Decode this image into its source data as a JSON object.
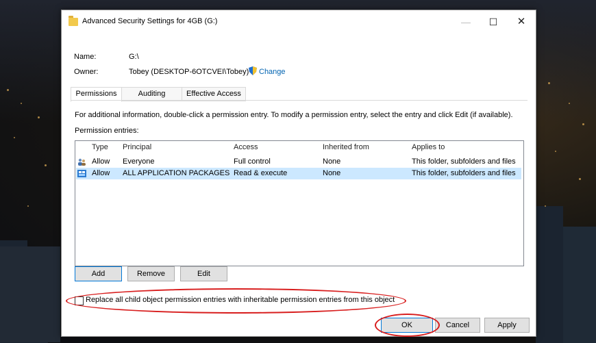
{
  "window": {
    "title": "Advanced Security Settings for 4GB (G:)",
    "minimize": "—",
    "maximize": "☐",
    "close": "✕"
  },
  "info": {
    "name_label": "Name:",
    "name_value": "G:\\",
    "owner_label": "Owner:",
    "owner_value": "Tobey (DESKTOP-6OTCVEI\\Tobey)",
    "change_link": "Change"
  },
  "tabs": [
    {
      "label": "Permissions",
      "active": true
    },
    {
      "label": "Auditing",
      "active": false
    },
    {
      "label": "Effective Access",
      "active": false
    }
  ],
  "instructions": "For additional information, double-click a permission entry. To modify a permission entry, select the entry and click Edit (if available).",
  "entries_label": "Permission entries:",
  "table": {
    "columns": [
      "Type",
      "Principal",
      "Access",
      "Inherited from",
      "Applies to"
    ],
    "rows": [
      {
        "icon": "users-icon",
        "type": "Allow",
        "principal": "Everyone",
        "access": "Full control",
        "inherited": "None",
        "applies": "This folder, subfolders and files",
        "selected": false
      },
      {
        "icon": "app-packages-icon",
        "type": "Allow",
        "principal": "ALL APPLICATION PACKAGES",
        "access": "Read & execute",
        "inherited": "None",
        "applies": "This folder, subfolders and files",
        "selected": true
      }
    ]
  },
  "buttons": {
    "add": "Add",
    "remove": "Remove",
    "edit": "Edit",
    "ok": "OK",
    "cancel": "Cancel",
    "apply": "Apply"
  },
  "replace_checkbox": {
    "label": "Replace all child object permission entries with inheritable permission entries from this object",
    "checked": false
  },
  "colors": {
    "accent": "#0078d7",
    "link": "#0063b1",
    "highlight_annotation": "#d81e1e",
    "selected_row": "#cce8ff"
  }
}
